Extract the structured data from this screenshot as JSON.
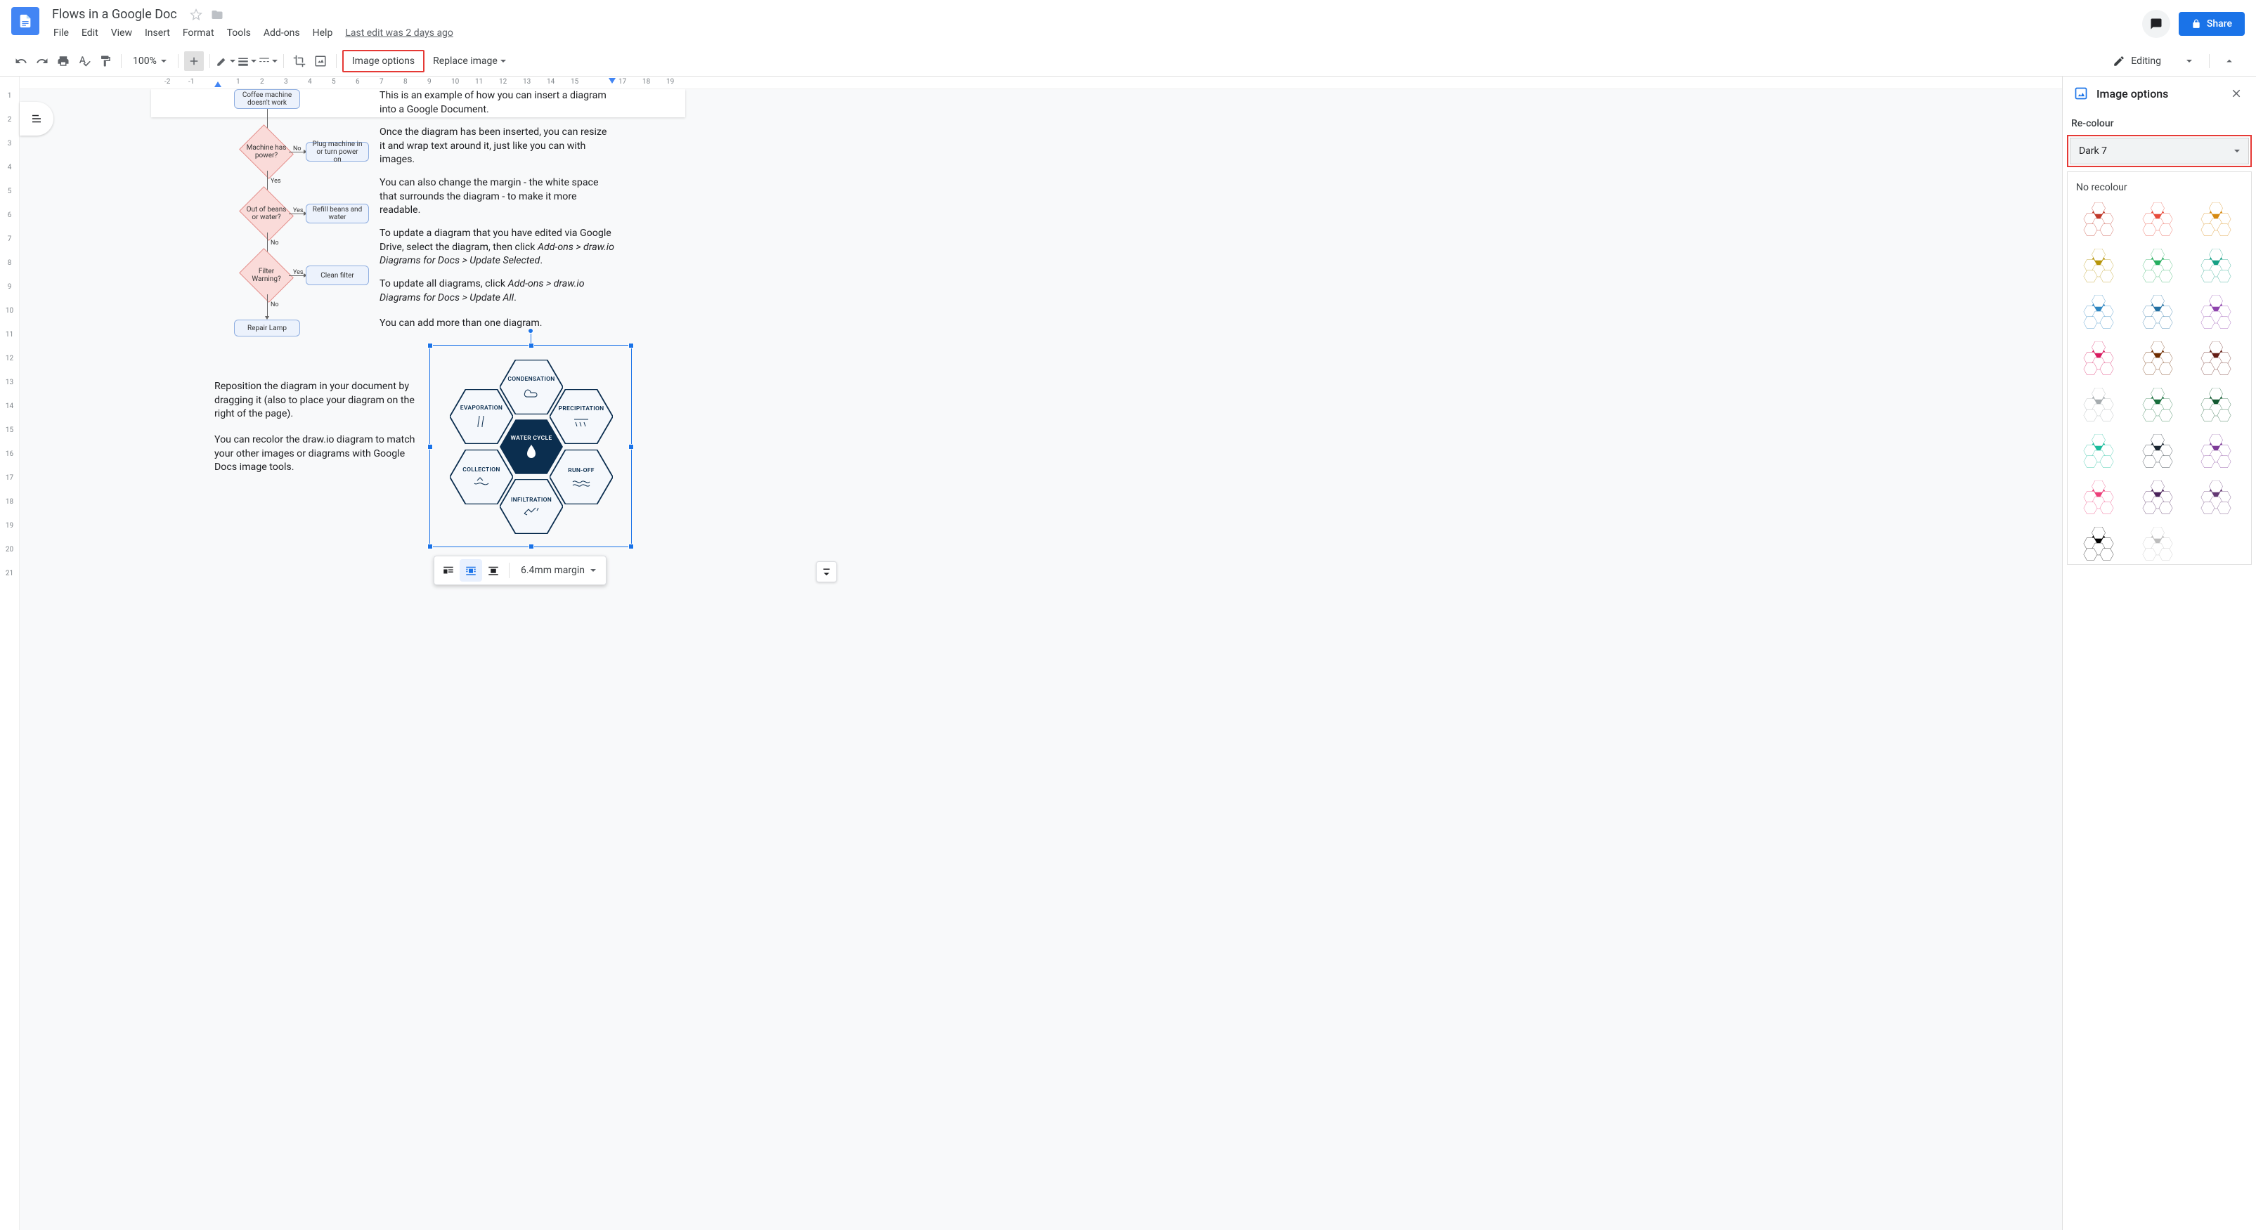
{
  "header": {
    "doc_title": "Flows in a Google Doc",
    "menus": [
      "File",
      "Edit",
      "View",
      "Insert",
      "Format",
      "Tools",
      "Add-ons",
      "Help"
    ],
    "last_edit": "Last edit was 2 days ago",
    "share_label": "Share"
  },
  "toolbar": {
    "zoom": "100%",
    "image_options": "Image options",
    "replace_image": "Replace image",
    "editing_mode": "Editing"
  },
  "ruler": {
    "top_ticks": [
      -2,
      -1,
      1,
      2,
      3,
      4,
      5,
      6,
      7,
      8,
      9,
      10,
      11,
      12,
      13,
      14,
      15,
      16,
      17,
      18,
      19
    ],
    "left_ticks": [
      1,
      2,
      3,
      4,
      5,
      6,
      7,
      8,
      9,
      10,
      11,
      12,
      13,
      14,
      15,
      16,
      17,
      18,
      19,
      20,
      21
    ]
  },
  "flowchart": {
    "start": "Coffee machine doesn't work",
    "d1": "Machine has power?",
    "d1_no": "No",
    "d1_yes": "Yes",
    "a1": "Plug machine in or turn power on",
    "d2": "Out of beans or water?",
    "d2_yes": "Yes",
    "d2_no": "No",
    "a2": "Refill beans and water",
    "d3": "Filter Warning?",
    "d3_yes": "Yes",
    "d3_no": "No",
    "a3": "Clean filter",
    "end": "Repair Lamp"
  },
  "doc_text": {
    "p1": "This is an example of how you can insert a diagram into a Google Document.",
    "p2": "Once the diagram has been inserted, you can resize it and wrap text around it, just like you can with images.",
    "p3": "You can also change the margin - the white space that surrounds the diagram - to make it more readable.",
    "p4a": "To update a diagram that you have edited via Google Drive, select the diagram, then click ",
    "p4b": "Add-ons > draw.io Diagrams for Docs > Update Selected",
    "p4c": ".",
    "p5a": "To update all diagrams, click ",
    "p5b": "Add-ons > draw.io Diagrams for Docs > Update All",
    "p5c": ".",
    "p6": "You can add more than one diagram.",
    "p7": "Reposition the diagram in your document by dragging it (also to place your diagram on the right of the page).",
    "p8": "You can recolor the draw.io diagram to match your other images or diagrams with Google Docs image tools."
  },
  "water_cycle": {
    "center": "WATER CYCLE",
    "cells": [
      "CONDENSATION",
      "PRECIPITATION",
      "RUN-OFF",
      "INFILTRATION",
      "COLLECTION",
      "EVAPORATION"
    ]
  },
  "wrap_toolbar": {
    "margin": "6.4mm margin"
  },
  "sidebar": {
    "title": "Image options",
    "section": "Re-colour",
    "current": "Dark 7",
    "no_recolour": "No recolour",
    "swatches": [
      "#c0392b",
      "#e74c3c",
      "#d68910",
      "#b7950b",
      "#27ae60",
      "#16a085",
      "#2e86c1",
      "#2471a3",
      "#8e44ad",
      "#d81b60",
      "#6e2c00",
      "#641e16",
      "#a6acaf",
      "#196f3d",
      "#145a32",
      "#1abc9c",
      "#1b2631",
      "#7d3c98",
      "#ec407a",
      "#4a235a",
      "#633974",
      "#000000",
      "#bdbdbd"
    ]
  }
}
